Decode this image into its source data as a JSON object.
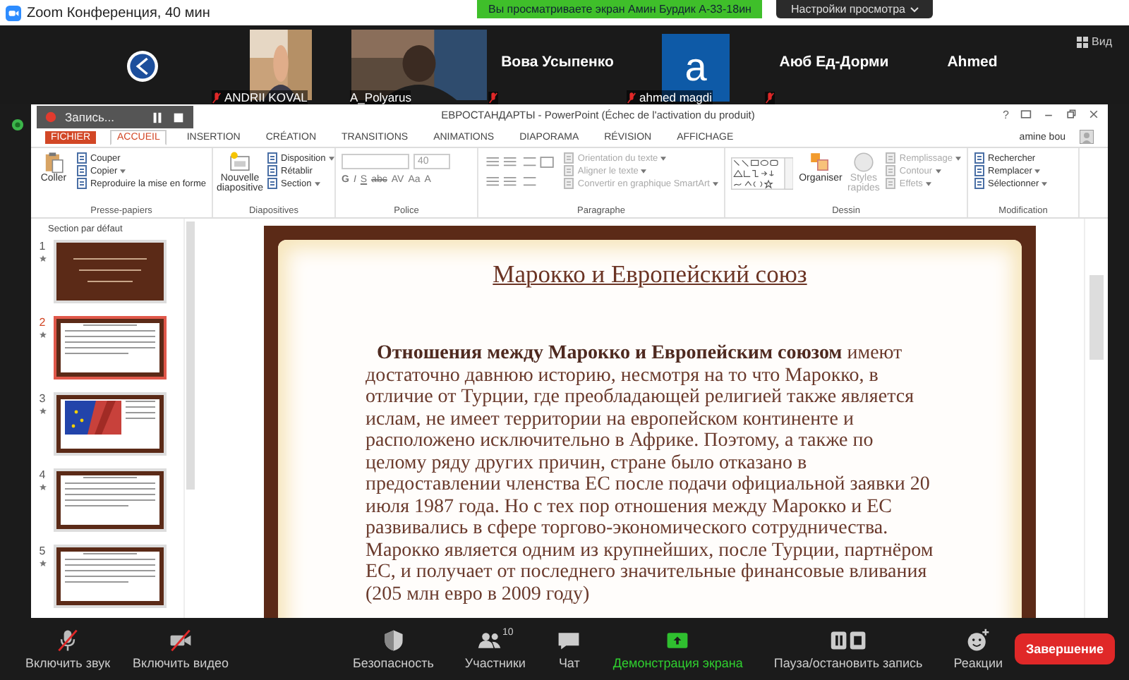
{
  "zoom_window": {
    "title": "Zoom Конференция, 40 мин"
  },
  "share_banner": {
    "text": "Вы просматриваете экран Амин Бурдик А-33-18ин",
    "view_options": "Настройки просмотра"
  },
  "participants": [
    {
      "kind": "logo"
    },
    {
      "kind": "video",
      "name": "ANDRII KOVAL",
      "muted": true
    },
    {
      "kind": "video",
      "name": "A_Polyarus",
      "muted": false
    },
    {
      "kind": "name",
      "name": "Вова Усыпенко",
      "muted": true
    },
    {
      "kind": "avatar",
      "name": "ahmed magdi",
      "initial": "a",
      "muted": true
    },
    {
      "kind": "name",
      "name": "Аюб Ед-Дорми",
      "muted": true
    },
    {
      "kind": "name",
      "name": "Ahmed"
    }
  ],
  "view_button": "Вид",
  "recording": {
    "label": "Запись..."
  },
  "powerpoint": {
    "title": "ЕВРОСТАНДАРТЫ - PowerPoint (Échec de l'activation du produit)",
    "help": "?",
    "user": "amine bou",
    "tabs": [
      {
        "label": "FICHIER",
        "kind": "file",
        "selected": false
      },
      {
        "label": "ACCUEIL",
        "kind": "tab",
        "selected": true
      },
      {
        "label": "INSERTION",
        "kind": "tab",
        "selected": false
      },
      {
        "label": "CRÉATION",
        "kind": "tab",
        "selected": false
      },
      {
        "label": "TRANSITIONS",
        "kind": "tab",
        "selected": false
      },
      {
        "label": "ANIMATIONS",
        "kind": "tab",
        "selected": false
      },
      {
        "label": "DIAPORAMA",
        "kind": "tab",
        "selected": false
      },
      {
        "label": "RÉVISION",
        "kind": "tab",
        "selected": false
      },
      {
        "label": "AFFICHAGE",
        "kind": "tab",
        "selected": false
      }
    ],
    "ribbon": [
      {
        "kind": "clipboard",
        "label": "Presse-papiers",
        "large": [
          {
            "kind": "clipboard",
            "label": "Coller",
            "disabled": false
          }
        ],
        "items": [
          {
            "label": "Couper",
            "disabled": false,
            "dropdown": false
          },
          {
            "label": "Copier",
            "disabled": false,
            "dropdown": true
          },
          {
            "label": "Reproduire la mise en forme",
            "disabled": false,
            "dropdown": false
          }
        ]
      },
      {
        "kind": "slides",
        "label": "Diapositives",
        "large": [
          {
            "kind": "slide",
            "label": "Nouvelle diapositive",
            "disabled": false
          }
        ],
        "items": [
          {
            "label": "Disposition",
            "disabled": false,
            "dropdown": true
          },
          {
            "label": "Rétablir",
            "disabled": false,
            "dropdown": false
          },
          {
            "label": "Section",
            "disabled": false,
            "dropdown": true
          }
        ]
      },
      {
        "kind": "font",
        "label": "Police",
        "font_size": "40",
        "format_buttons": [
          "G",
          "I",
          "S",
          "abc",
          "AV",
          "Aa",
          "A"
        ]
      },
      {
        "kind": "paragraph",
        "label": "Paragraphe",
        "items": [
          {
            "label": "Orientation du texte",
            "disabled": true,
            "dropdown": true
          },
          {
            "label": "Aligner le texte",
            "disabled": true,
            "dropdown": true
          },
          {
            "label": "Convertir en graphique SmartArt",
            "disabled": true,
            "dropdown": true
          }
        ]
      },
      {
        "kind": "drawing",
        "label": "Dessin",
        "large": [
          {
            "kind": "arrange",
            "label": "Organiser",
            "disabled": false
          },
          {
            "kind": "styles",
            "label": "Styles rapides",
            "disabled": true
          }
        ],
        "items": [
          {
            "label": "Remplissage",
            "disabled": true,
            "dropdown": true
          },
          {
            "label": "Contour",
            "disabled": true,
            "dropdown": true
          },
          {
            "label": "Effets",
            "disabled": true,
            "dropdown": true
          }
        ]
      },
      {
        "kind": "editing",
        "label": "Modification",
        "items": [
          {
            "label": "Rechercher",
            "disabled": false,
            "dropdown": false
          },
          {
            "label": "Remplacer",
            "disabled": false,
            "dropdown": true
          },
          {
            "label": "Sélectionner",
            "disabled": false,
            "dropdown": true
          }
        ]
      }
    ],
    "section": "Section par défaut",
    "slides": [
      {
        "number": "1",
        "kind": "title",
        "selected": false
      },
      {
        "number": "2",
        "kind": "text",
        "selected": true
      },
      {
        "number": "3",
        "selected": false
      },
      {
        "number": "4",
        "kind": "text",
        "selected": false
      },
      {
        "number": "5",
        "kind": "text",
        "selected": false
      }
    ],
    "slide": {
      "title": "Марокко и Европейский союз",
      "body": "**Отношения между Марокко и Европейским союзом** имеют достаточно давнюю историю, несмотря на то что Марокко, в отличие от Турции, где преобладающей религией также является ислам, не имеет территории на европейском континенте и расположено исключительно в Африке. Поэтому, а также по целому ряду других причин, стране было отказано в предоставлении членства ЕС после подачи официальной заявки 20 июля 1987 года. Но с тех пор отношения между Марокко и ЕС развивались в сфере торгово-экономического сотрудничества. Марокко является одним из крупнейших, после Турции, партнёром ЕС, и получает от последнего значительные финансовые вливания (205 млн евро в 2009 году)"
    }
  },
  "toolbar": {
    "left": [
      {
        "kind": "mic",
        "label": "Включить звук",
        "off": true
      },
      {
        "kind": "video",
        "label": "Включить видео",
        "off": true
      }
    ],
    "center": [
      {
        "kind": "security",
        "label": "Безопасность",
        "active": false
      },
      {
        "kind": "participants",
        "label": "Участники",
        "count": "10",
        "active": false
      },
      {
        "kind": "chat",
        "label": "Чат",
        "active": false
      },
      {
        "kind": "share",
        "label": "Демонстрация экрана",
        "active": true
      },
      {
        "kind": "record",
        "label": "Пауза/остановить запись",
        "active": false
      },
      {
        "kind": "reactions",
        "label": "Реакции",
        "active": false
      }
    ],
    "end_button": "Завершение"
  }
}
